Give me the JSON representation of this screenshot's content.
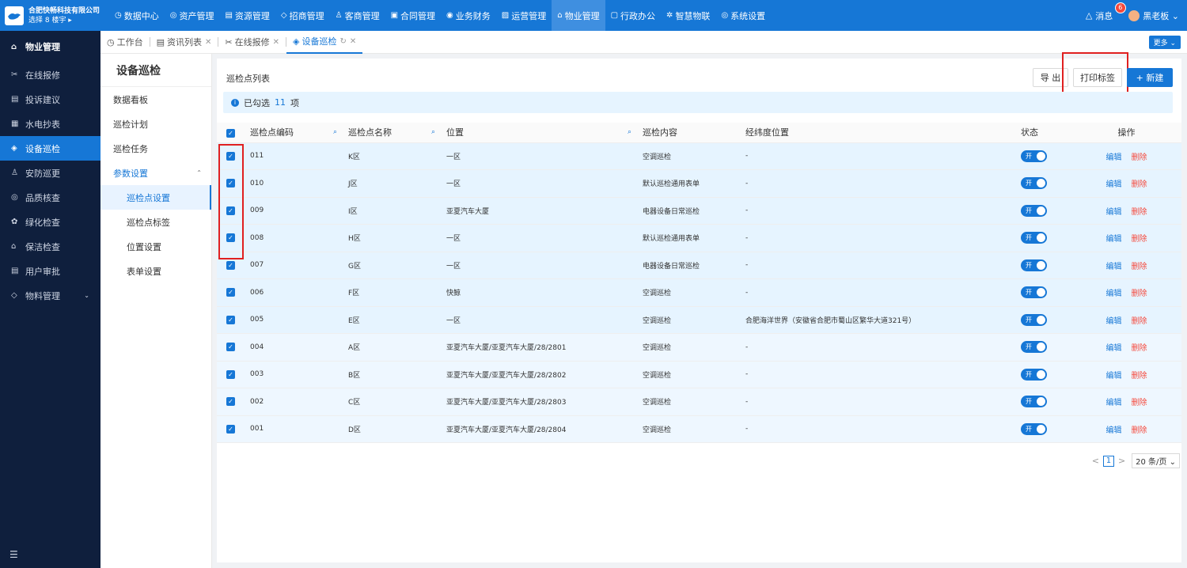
{
  "brand": {
    "name": "合肥快畅科技有限公司",
    "sub": "选择 8 楼宇 ▸"
  },
  "topnav": [
    {
      "icon": "◷",
      "label": "数据中心"
    },
    {
      "icon": "◎",
      "label": "资产管理"
    },
    {
      "icon": "▤",
      "label": "资源管理"
    },
    {
      "icon": "◇",
      "label": "招商管理"
    },
    {
      "icon": "♙",
      "label": "客商管理"
    },
    {
      "icon": "▣",
      "label": "合同管理"
    },
    {
      "icon": "◉",
      "label": "业务财务"
    },
    {
      "icon": "▨",
      "label": "运营管理"
    },
    {
      "icon": "⌂",
      "label": "物业管理"
    },
    {
      "icon": "▢",
      "label": "行政办公"
    },
    {
      "icon": "✲",
      "label": "智慧物联"
    },
    {
      "icon": "◎",
      "label": "系统设置"
    }
  ],
  "messages": {
    "label": "消息",
    "count": "6"
  },
  "user": {
    "name": "黑老板 ⌄"
  },
  "sidebar": {
    "title": "物业管理",
    "items": [
      {
        "icon": "✂",
        "label": "在线报修"
      },
      {
        "icon": "▤",
        "label": "投诉建议"
      },
      {
        "icon": "▦",
        "label": "水电抄表"
      },
      {
        "icon": "◈",
        "label": "设备巡检"
      },
      {
        "icon": "♙",
        "label": "安防巡更"
      },
      {
        "icon": "◎",
        "label": "品质核查"
      },
      {
        "icon": "✿",
        "label": "绿化检查"
      },
      {
        "icon": "⌂",
        "label": "保洁检查"
      },
      {
        "icon": "▤",
        "label": "用户审批"
      },
      {
        "icon": "◇",
        "label": "物料管理"
      }
    ]
  },
  "tabs": [
    {
      "icon": "◷",
      "label": "工作台"
    },
    {
      "icon": "▤",
      "label": "资讯列表"
    },
    {
      "icon": "✂",
      "label": "在线报修"
    },
    {
      "icon": "◈",
      "label": "设备巡检"
    }
  ],
  "more": "更多 ⌄",
  "submenu": {
    "title": "设备巡检",
    "items": [
      "数据看板",
      "巡检计划",
      "巡检任务",
      "参数设置"
    ],
    "sub_items": [
      "巡检点设置",
      "巡检点标签",
      "位置设置",
      "表单设置"
    ]
  },
  "main": {
    "list_title": "巡检点列表",
    "export": "导 出",
    "print": "打印标签",
    "new": "+ 新建",
    "alert_prefix": "已勾选",
    "alert_count": "11",
    "alert_suffix": "项",
    "columns": [
      "巡检点编码",
      "巡检点名称",
      "位置",
      "巡检内容",
      "经纬度位置",
      "状态",
      "操作"
    ],
    "rows": [
      {
        "code": "011",
        "name": "K区",
        "location": "一区",
        "content": "空调巡检",
        "coords": "-"
      },
      {
        "code": "010",
        "name": "J区",
        "location": "一区",
        "content": "默认巡检通用表单",
        "coords": "-"
      },
      {
        "code": "009",
        "name": "I区",
        "location": "亚夏汽车大厦",
        "content": "电器设备日常巡检",
        "coords": "-"
      },
      {
        "code": "008",
        "name": "H区",
        "location": "一区",
        "content": "默认巡检通用表单",
        "coords": "-"
      },
      {
        "code": "007",
        "name": "G区",
        "location": "一区",
        "content": "电器设备日常巡检",
        "coords": "-"
      },
      {
        "code": "006",
        "name": "F区",
        "location": "快鲸",
        "content": "空调巡检",
        "coords": "-"
      },
      {
        "code": "005",
        "name": "E区",
        "location": "一区",
        "content": "空调巡检",
        "coords": "合肥海洋世界（安徽省合肥市蜀山区繁华大道321号）"
      },
      {
        "code": "004",
        "name": "A区",
        "location": "亚夏汽车大厦/亚夏汽车大厦/28/2801",
        "content": "空调巡检",
        "coords": "-"
      },
      {
        "code": "003",
        "name": "B区",
        "location": "亚夏汽车大厦/亚夏汽车大厦/28/2802",
        "content": "空调巡检",
        "coords": "-"
      },
      {
        "code": "002",
        "name": "C区",
        "location": "亚夏汽车大厦/亚夏汽车大厦/28/2803",
        "content": "空调巡检",
        "coords": "-"
      },
      {
        "code": "001",
        "name": "D区",
        "location": "亚夏汽车大厦/亚夏汽车大厦/28/2804",
        "content": "空调巡检",
        "coords": "-"
      }
    ],
    "status_on": "开",
    "edit": "编辑",
    "delete": "删除",
    "pager": {
      "prev": "<",
      "page": "1",
      "next": ">",
      "size": "20 条/页 ⌄"
    }
  },
  "colors": {
    "primary": "#1677d6",
    "sidebar": "#0f1f3d",
    "danger": "#f5483b",
    "highlight": "#e02020"
  }
}
